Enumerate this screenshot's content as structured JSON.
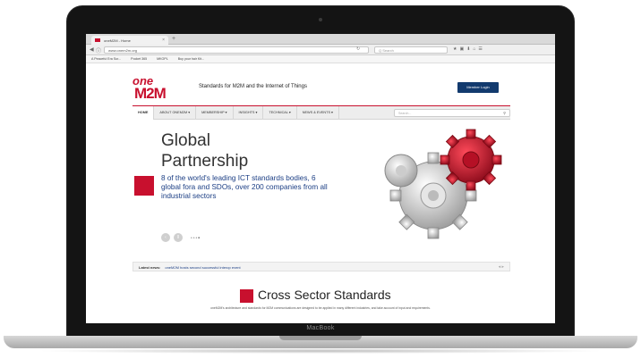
{
  "device": {
    "brand_label": "MacBook"
  },
  "browser": {
    "tab_title": "oneM2M - Home",
    "new_tab_symbol": "+",
    "url": "www.onem2m.org",
    "search_placeholder": "Q Search",
    "bookmarks": [
      "A Peaceful Era Sur...",
      "Pocket 365",
      "MKOPL",
      "Buy your hair Kit..."
    ]
  },
  "site": {
    "logo_top": "one",
    "logo_bottom": "M2M",
    "tagline": "Standards for M2M and the Internet of Things",
    "member_login": "Member Login",
    "menu": [
      "HOME",
      "ABOUT ONEM2M ▾",
      "MEMBERSHIP ▾",
      "INSIGHTS ▾",
      "TECHNICAL ▾",
      "NEWS & EVENTS ▾"
    ],
    "menu_search_placeholder": "Search...",
    "hero_title_line1": "Global",
    "hero_title_line2": "Partnership",
    "hero_text": "8 of the world's leading ICT standards bodies, 6 global fora and SDOs, over 200 companies from all industrial sectors",
    "news_label": "Latest news:",
    "news_item": "oneM2M hosts second successful interop event",
    "section_title": "Cross Sector Standards",
    "section_subtitle": "oneM2M's architecture and standards for M2M communications are designed to be applied in many different industries, and take account of input and requirements."
  },
  "colors": {
    "brand_red": "#c8102e",
    "brand_blue": "#1b3e84",
    "member_btn": "#123a6e"
  }
}
